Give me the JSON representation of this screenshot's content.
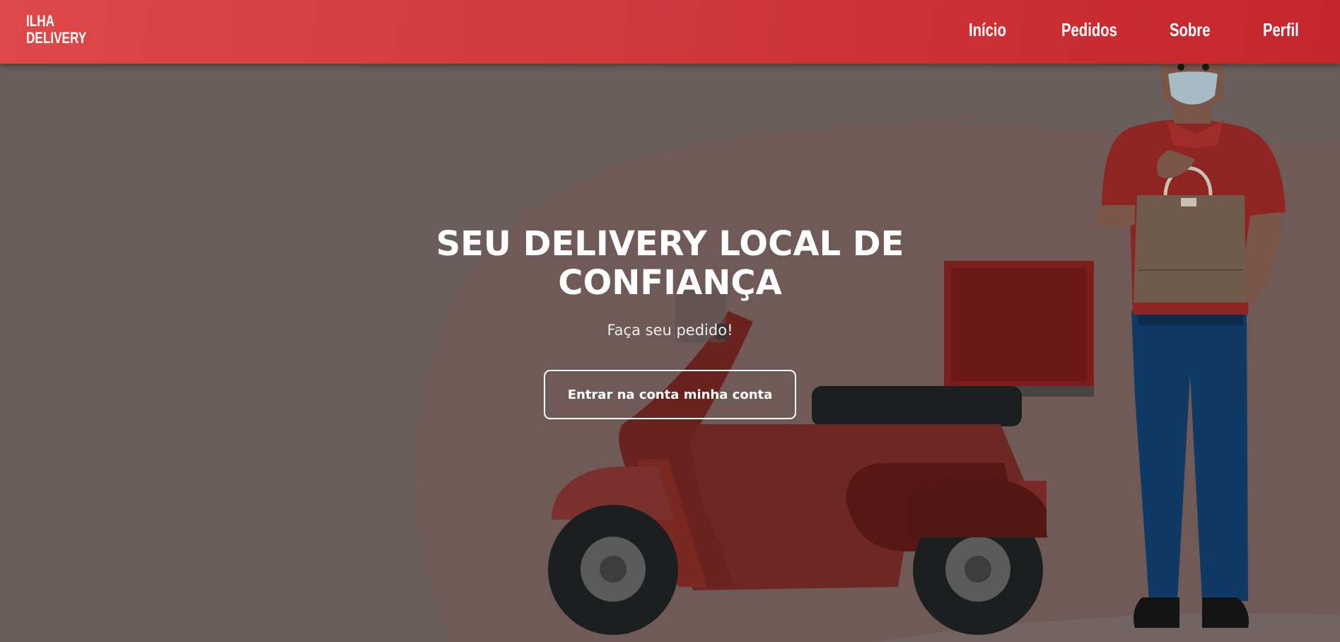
{
  "navbar": {
    "logo": {
      "line1": "ILHA",
      "line2": "DELIVERY"
    },
    "links": [
      {
        "label": "Início"
      },
      {
        "label": "Pedidos"
      },
      {
        "label": "Sobre"
      },
      {
        "label": "Perfil"
      }
    ]
  },
  "hero": {
    "title_line1": "SEU DELIVERY LOCAL DE",
    "title_line2": "CONFIANÇA",
    "subtitle": "Faça seu pedido!",
    "cta_label": "Entrar na conta minha conta"
  },
  "colors": {
    "navbar_red": "#d03a3d",
    "overlay": "#695e5c",
    "scooter_red": "#8a2a25",
    "jeans_blue": "#0f3a66"
  }
}
